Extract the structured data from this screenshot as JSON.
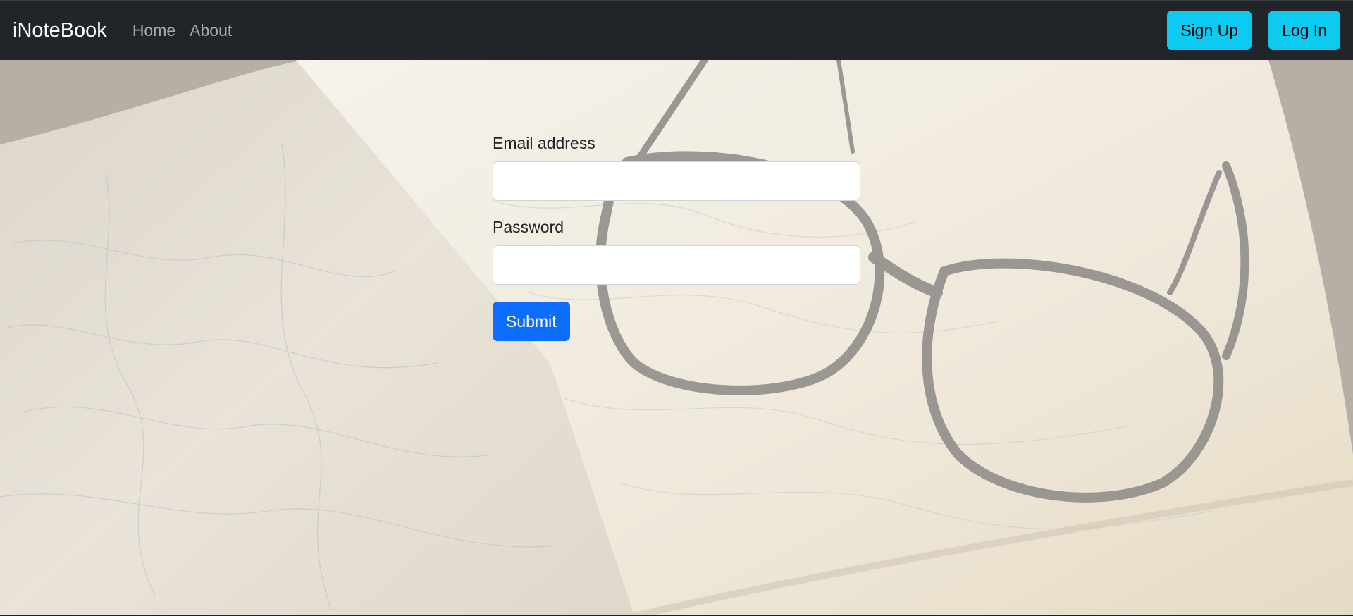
{
  "navbar": {
    "brand": "iNoteBook",
    "links": [
      "Home",
      "About"
    ],
    "signup_label": "Sign Up",
    "login_label": "Log In"
  },
  "form": {
    "email_label": "Email address",
    "email_value": "",
    "password_label": "Password",
    "password_value": "",
    "submit_label": "Submit"
  },
  "colors": {
    "navbar_bg": "#212529",
    "info_button": "#0dcaf0",
    "primary_button": "#0d6efd"
  }
}
